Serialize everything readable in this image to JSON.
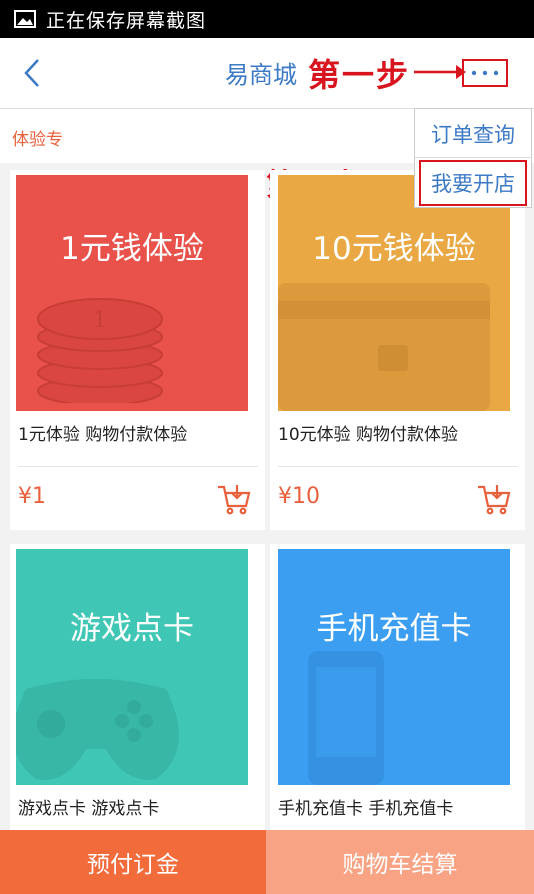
{
  "status_bar": {
    "text": "正在保存屏幕截图"
  },
  "header": {
    "title": "易商城"
  },
  "annotations": {
    "step1": "第一步",
    "step2": "第二步"
  },
  "tab": {
    "label": "体验专"
  },
  "menu": {
    "items": [
      "订单查询",
      "我要开店"
    ]
  },
  "products": [
    {
      "image_text": "1元钱体验",
      "name": "1元体验  购物付款体验",
      "price": "¥1",
      "color": "#e8524a"
    },
    {
      "image_text": "10元钱体验",
      "name": "10元体验  购物付款体验",
      "price": "¥10",
      "color": "#eaa844"
    },
    {
      "image_text": "游戏点卡",
      "name": "游戏点卡  游戏点卡",
      "color": "#3fc6b4"
    },
    {
      "image_text": "手机充值卡",
      "name": "手机充值卡  手机充值卡",
      "color": "#3b9ef0"
    }
  ],
  "bottom": {
    "deposit": "预付订金",
    "checkout": "购物车结算"
  },
  "colors": {
    "accent": "#f26b3a",
    "link": "#3d7ac6",
    "annotation": "#d8141e"
  }
}
